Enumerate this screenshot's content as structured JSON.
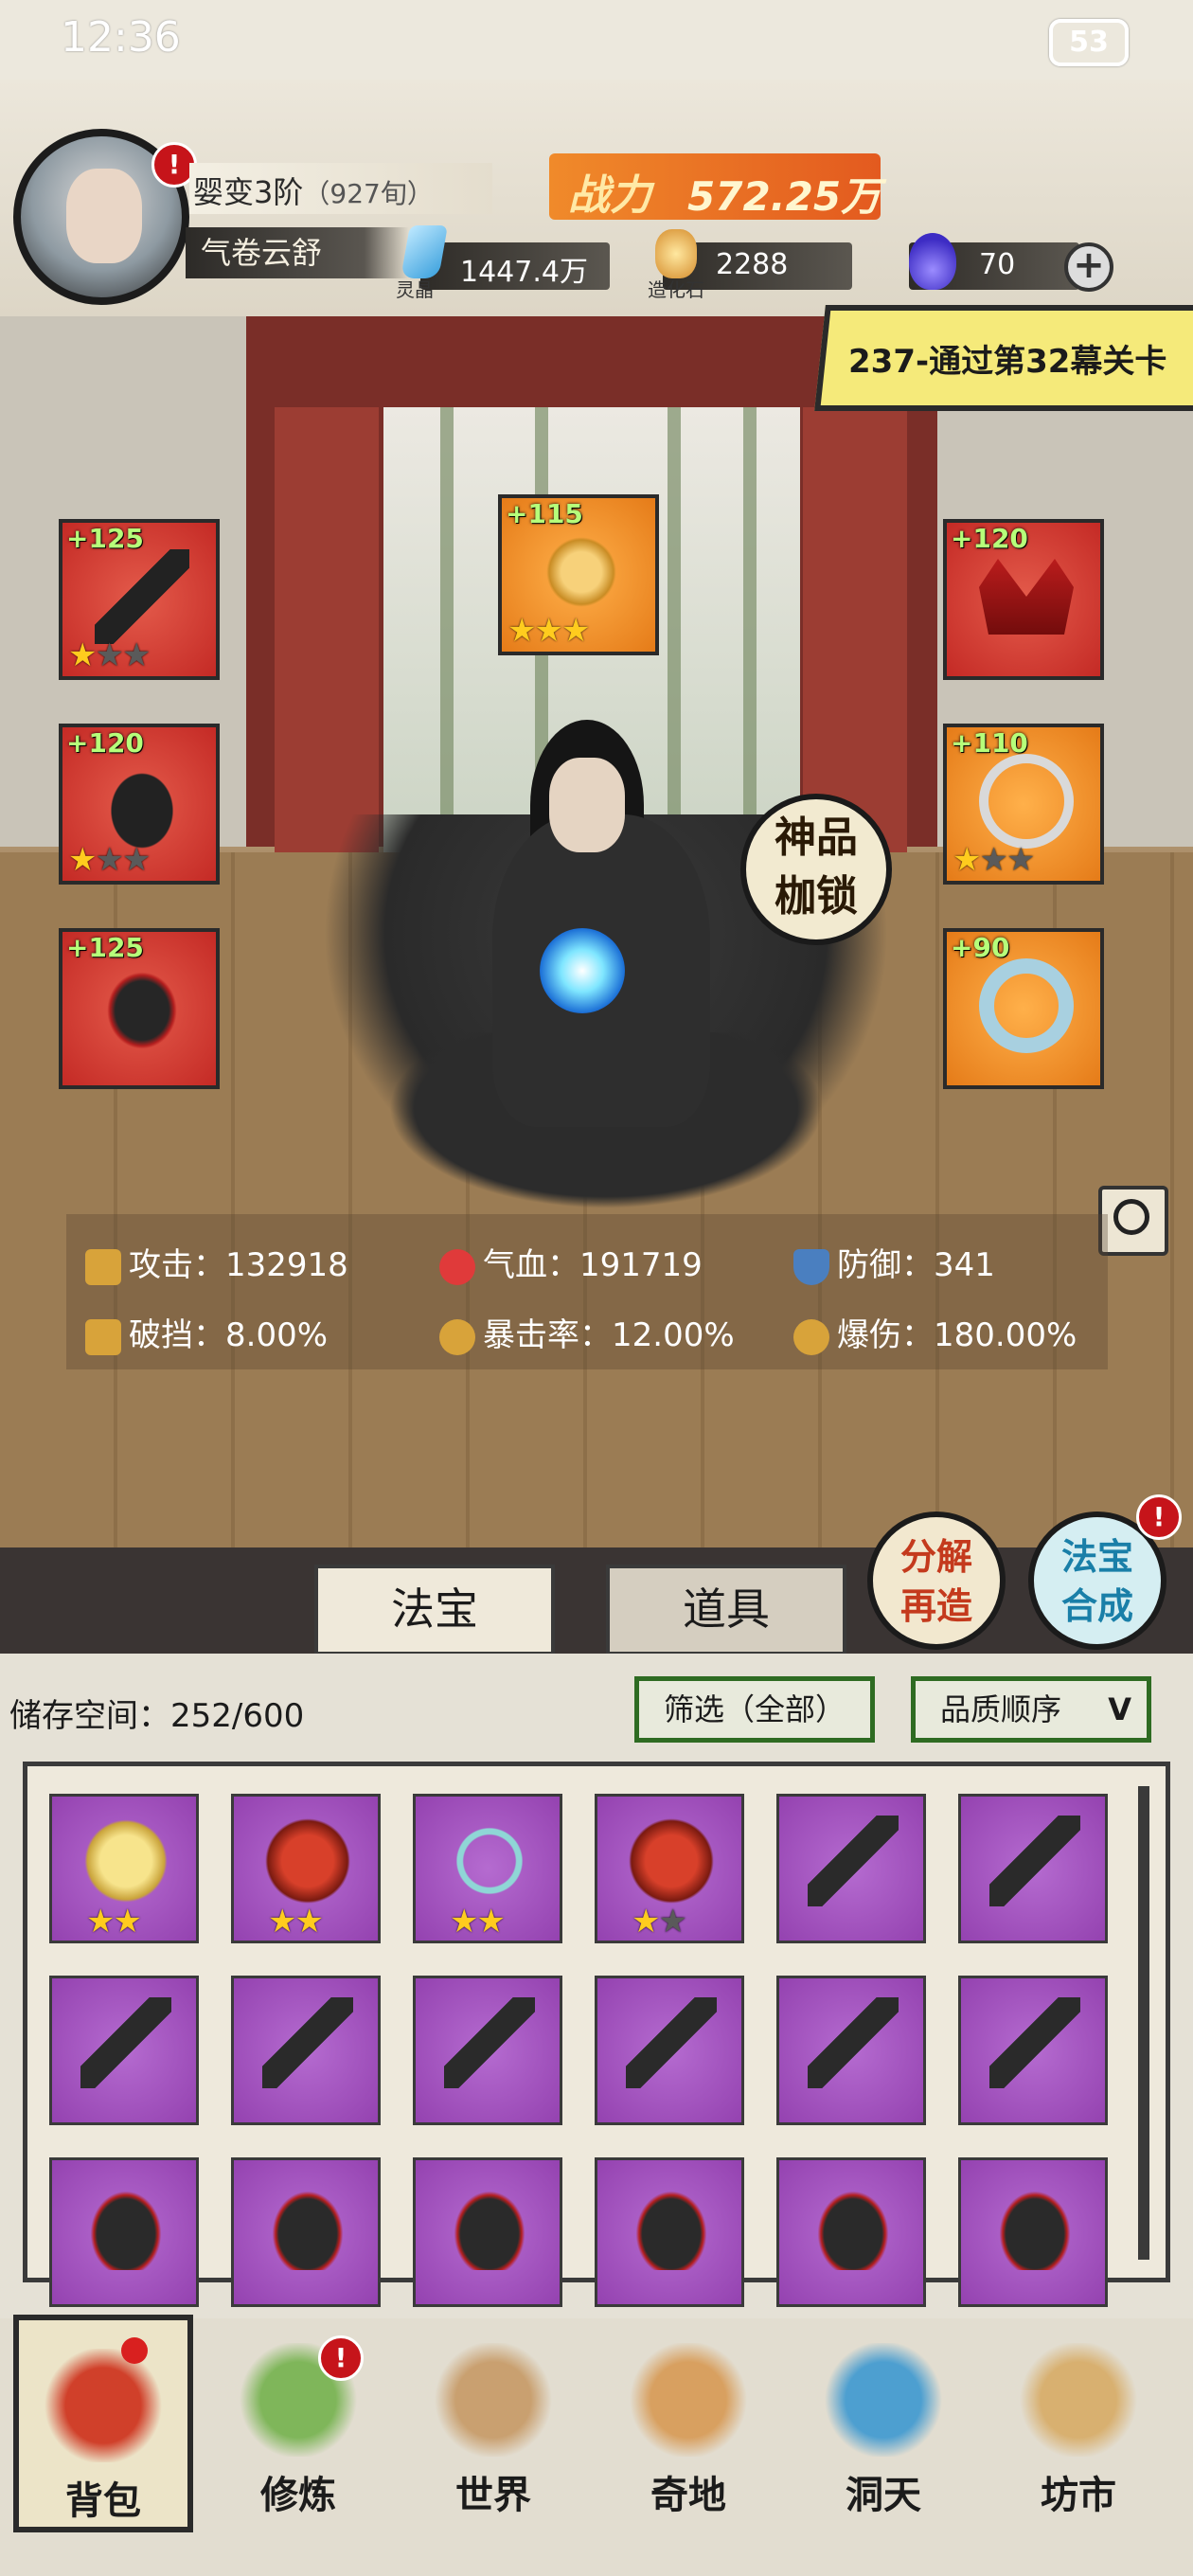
{
  "status": {
    "time": "12:36",
    "battery": "53"
  },
  "player": {
    "rank": "婴变3阶",
    "age": "（927旬）",
    "title": "气卷云舒",
    "power_label": "战力",
    "power_value": "572.25万"
  },
  "resources": [
    {
      "label": "灵晶",
      "value": "1447.4万",
      "icon": "crystal-icon"
    },
    {
      "label": "造化石",
      "value": "2288",
      "icon": "stone-icon"
    },
    {
      "label": "",
      "value": "70",
      "icon": "flame-icon"
    }
  ],
  "quest": {
    "text": "237-通过第32幕关卡"
  },
  "equipment": {
    "left": [
      {
        "level": "+125",
        "stars": 1,
        "icon": "sword-icon"
      },
      {
        "level": "+120",
        "stars": 1,
        "icon": "robe-icon"
      },
      {
        "level": "+125",
        "stars": 0,
        "icon": "boots-icon"
      }
    ],
    "center": {
      "level": "+115",
      "stars": 3,
      "icon": "cloud-treasure-icon"
    },
    "right": [
      {
        "level": "+120",
        "stars": 0,
        "icon": "crown-icon"
      },
      {
        "level": "+110",
        "stars": 1,
        "icon": "necklace-icon"
      },
      {
        "level": "+90",
        "stars": 0,
        "icon": "bracelet-icon"
      }
    ]
  },
  "god_shackle": {
    "line1": "神品",
    "line2": "枷锁"
  },
  "stats": {
    "attack": "攻击：132918",
    "hp": "气血：191719",
    "defense": "防御：341",
    "break": "破挡：8.00%",
    "crit_rate": "暴击率：12.00%",
    "crit_dmg": "爆伤：180.00%"
  },
  "actions": {
    "decompose": {
      "line1": "分解",
      "line2": "再造"
    },
    "synth": {
      "line1": "法宝",
      "line2": "合成"
    }
  },
  "tabs": {
    "treasure": "法宝",
    "items": "道具"
  },
  "storage": {
    "label": "储存空间：252/600",
    "filter": "筛选（全部）",
    "sort": "品质顺序"
  },
  "grid": [
    {
      "icon": "mirror-icon",
      "stars": 2,
      "max": 2
    },
    {
      "icon": "demon-mask-icon",
      "stars": 2,
      "max": 2
    },
    {
      "icon": "dragon-necklace-icon",
      "stars": 2,
      "max": 2
    },
    {
      "icon": "demon-mask-icon",
      "stars": 1,
      "max": 2
    },
    {
      "icon": "sword-icon",
      "stars": 0,
      "max": 0
    },
    {
      "icon": "sword-icon",
      "stars": 0,
      "max": 0
    },
    {
      "icon": "sword-icon",
      "stars": 0,
      "max": 0
    },
    {
      "icon": "sword-icon",
      "stars": 0,
      "max": 0
    },
    {
      "icon": "sword-icon",
      "stars": 0,
      "max": 0
    },
    {
      "icon": "sword-icon",
      "stars": 0,
      "max": 0
    },
    {
      "icon": "sword-icon",
      "stars": 0,
      "max": 0
    },
    {
      "icon": "sword-icon",
      "stars": 0,
      "max": 0
    },
    {
      "icon": "robe-icon",
      "stars": 0,
      "max": 0
    },
    {
      "icon": "robe-icon",
      "stars": 0,
      "max": 0
    },
    {
      "icon": "robe-icon",
      "stars": 0,
      "max": 0
    },
    {
      "icon": "robe-icon",
      "stars": 0,
      "max": 0
    },
    {
      "icon": "robe-icon",
      "stars": 0,
      "max": 0
    },
    {
      "icon": "robe-icon",
      "stars": 0,
      "max": 0
    }
  ],
  "nav": [
    {
      "label": "背包",
      "icon": "bag-icon",
      "color": "#d0402a"
    },
    {
      "label": "修炼",
      "icon": "lotus-icon",
      "color": "#7fb65a"
    },
    {
      "label": "世界",
      "icon": "scroll-map-icon",
      "color": "#c9a070"
    },
    {
      "label": "奇地",
      "icon": "pagoda-icon",
      "color": "#d8a060"
    },
    {
      "label": "洞天",
      "icon": "portal-icon",
      "color": "#4d9fd0"
    },
    {
      "label": "坊市",
      "icon": "market-stall-icon",
      "color": "#d8b070"
    }
  ]
}
